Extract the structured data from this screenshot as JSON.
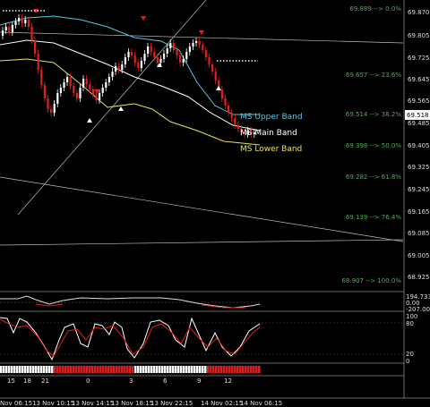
{
  "price_axis": [
    "69.870",
    "69.805",
    "69.725",
    "69.645",
    "69.565",
    "69.485",
    "69.405",
    "69.325",
    "69.245",
    "69.165",
    "69.085",
    "69.005",
    "68.925"
  ],
  "current_price": "69.518",
  "fib_levels": [
    {
      "label": "69.889 --> 0.0%"
    },
    {
      "label": "69.657 --> 23.6%"
    },
    {
      "label": "69.514 --> 38.2%"
    },
    {
      "label": "69.398 --> 50.0%"
    },
    {
      "label": "69.282 --> 61.8%"
    },
    {
      "label": "69.139 --> 76.4%"
    },
    {
      "label": "68.907 --> 100.0%"
    }
  ],
  "band_labels": {
    "upper": "MS Upper Band",
    "main": "MS Main Band",
    "lower": "MS Lower Band"
  },
  "colors": {
    "upper": "#55c8e0",
    "main": "#ffffff",
    "lower": "#e8e060",
    "fib": "#4caf50",
    "bull": "#ffffff",
    "bear": "#e0201c"
  },
  "osc1_axis": [
    "194.7332",
    "0.00",
    "-207.006"
  ],
  "osc2_axis": [
    "100",
    "80",
    "20",
    "0"
  ],
  "osc3_axis": [
    "",
    "",
    ""
  ],
  "time_axis": [
    "Nov 06:15",
    "13 Nov 10:15",
    "13 Nov 14:15",
    "13 Nov 18:15",
    "13 Nov 22:15",
    "14 Nov 02:15",
    "14 Nov 06:15"
  ],
  "session_numbers": [
    "15",
    "18",
    "21",
    "0",
    "3",
    "6",
    "9",
    "12"
  ]
}
